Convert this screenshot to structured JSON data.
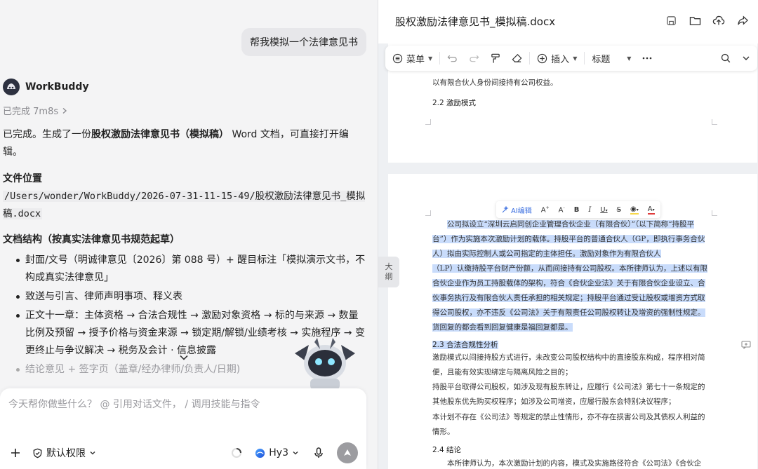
{
  "chat": {
    "user_message": "帮我模拟一个法律意见书",
    "agent_name": "WorkBuddy",
    "status": "已完成 7m8s",
    "intro_pre": "已完成。生成了一份",
    "intro_bold": "股权激励法律意见书（模拟稿）",
    "intro_post": " Word 文档，可直接打开编辑。",
    "file_heading": "文件位置",
    "file_path": "/Users/wonder/WorkBuddy/2026-07-31-11-15-49/股权激励法律意见书_模拟稿.docx",
    "structure_heading": "文档结构（按真实法律意见书规范起草）",
    "bullets": [
      "封面/文号（明诚律意见〔2026〕第 088 号）+ 醒目标注「模拟演示文书，不构成真实法律意见」",
      "致送与引言、律师声明事项、释义表",
      "正文十一章：主体资格 → 合法合规性 → 激励对象资格 → 标的与来源 → 数量比例及预留 → 授予价格与资金来源 → 锁定期/解锁/业绩考核 → 实施程序 → 变更终止与争议解决 → 税务及会计 · 信息披露",
      "结论意见 + 签字页（盖章/经办律师/负责人/日期)"
    ],
    "composer": {
      "placeholder": "今天帮你做些什么？ @ 引用对话文件， / 调用技能与指令",
      "permission_label": "默认权限",
      "model_label": "Hy3"
    }
  },
  "doc": {
    "title": "股权激励法律意见书_模拟稿.docx",
    "toolbar": {
      "menu_label": "菜单",
      "insert_label": "插入",
      "style_label": "标题"
    },
    "outline_tab": [
      "大",
      "纲"
    ],
    "page1": {
      "line1": "以有限合伙人身份间接持有公司权益。",
      "heading": "2.2 激励模式"
    },
    "float_toolbar": {
      "ai_edit": "AI编辑"
    },
    "page2": {
      "para_selected": [
        "公司拟设立“深圳云启同创企业管理合伙企业（有限合伙）”（以下简称“持股平",
        "台”）作为实施本次激励计划的载体。持股平台的普通合伙人（GP，即执行事务合伙",
        "人）拟由实际控制人或公司指定的主体担任。激励对象作为有限合伙人",
        "（LP）认缴持股平台财产份额，从而间接持有公司股权。本所律师认为，上述以有限",
        "合伙企业作为员工持股载体的架构，符合《合伙企业法》关于有限合伙企业设立、合",
        "伙事务执行及有限合伙人责任承担的相关规定；持股平台通过受让股权或增资方式取",
        "得公司股权，亦不违反《公司法》关于有限责任公司股权转让及增资的强制性规定。",
        "货回复的都会看到回复健康是福回复都是。"
      ],
      "heading_23": "2.3 合法合规性分析",
      "para_23": [
        "激励模式以间接持股方式进行，未改变公司股权结构中的直接股东构成，程序相对简",
        "便，且能有效实现绑定与隔离风险之目的；"
      ],
      "para_23b": [
        "持股平台取得公司股权，如涉及现有股东转让，应履行《公司法》第七十一条规定的",
        "其他股东优先购买权程序；如涉及公司增资，应履行股东会特别决议程序；"
      ],
      "para_23c": [
        "本计划不存在《公司法》等规定的禁止性情形，亦不存在损害公司及其债权人利益的",
        "情形。"
      ],
      "heading_24": "2.4 结论",
      "para_24": "本所律师认为，本次激励计划的内容，模式及实施路径符合《公司法》《合伙企"
    }
  },
  "colors": {
    "selection": "#c9dcfb",
    "accent": "#3b6fe0",
    "send_button": "#9c9ca0"
  },
  "icons": [
    "chevron-right-icon",
    "chevron-down-icon",
    "plus-icon",
    "shield-check-icon",
    "spinner-icon",
    "globe-icon",
    "mic-icon",
    "send-arrow-icon",
    "save-icon",
    "folder-icon",
    "upload-icon",
    "share-icon",
    "menu-icon",
    "undo-icon",
    "redo-icon",
    "format-painter-icon",
    "eraser-icon",
    "insert-plus-icon",
    "more-icon",
    "search-icon",
    "collapse-icon",
    "comment-icon"
  ]
}
